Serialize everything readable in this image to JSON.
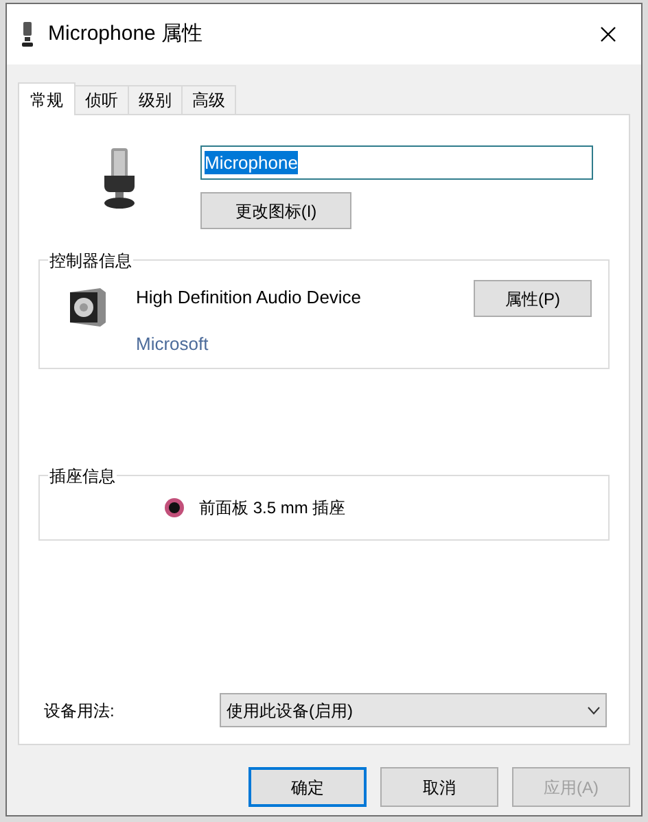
{
  "window": {
    "title": "Microphone 属性"
  },
  "tabs": [
    {
      "label": "常规",
      "selected": true
    },
    {
      "label": "侦听",
      "selected": false
    },
    {
      "label": "级别",
      "selected": false
    },
    {
      "label": "高级",
      "selected": false
    }
  ],
  "name_field": {
    "value": "Microphone"
  },
  "change_icon_button": "更改图标(I)",
  "controller": {
    "title": "控制器信息",
    "device": "High Definition Audio Device",
    "vendor": "Microsoft",
    "button": "属性(P)"
  },
  "jack": {
    "title": "插座信息",
    "label": "前面板 3.5 mm 插座",
    "color": "#c2507a"
  },
  "usage": {
    "label": "设备用法:",
    "value": "使用此设备(启用)"
  },
  "buttons": [
    {
      "label": "确定",
      "default": true,
      "disabled": false
    },
    {
      "label": "取消",
      "default": false,
      "disabled": false
    },
    {
      "label": "应用(A)",
      "default": false,
      "disabled": true
    }
  ]
}
